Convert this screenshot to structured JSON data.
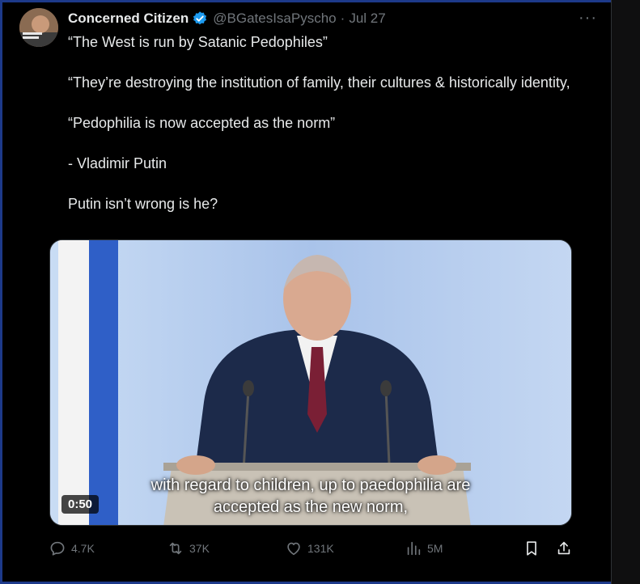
{
  "tweet": {
    "author_name": "Concerned Citizen",
    "handle": "@BGatesIsaPyscho",
    "separator": "·",
    "date": "Jul 27",
    "more_label": "···",
    "paragraphs": [
      "“The West is run by Satanic Pedophiles”",
      "“They’re destroying the institution of family, their cultures & historically identity,",
      "“Pedophilia is now accepted as the norm”",
      "- Vladimir Putin",
      "Putin isn’t wrong is he?"
    ]
  },
  "media": {
    "subtitle_line1": "with regard to children, up to paedophilia are",
    "subtitle_line2": "accepted as the new norm,",
    "duration": "0:50"
  },
  "actions": {
    "replies": "4.7K",
    "reposts": "37K",
    "likes": "131K",
    "views": "5M"
  },
  "icons": {
    "verified": "verified-badge-icon",
    "reply": "reply-icon",
    "repost": "repost-icon",
    "like": "heart-icon",
    "views": "views-icon",
    "bookmark": "bookmark-icon",
    "share": "share-icon"
  },
  "colors": {
    "background": "#000000",
    "text": "#e7e9ea",
    "muted": "#71767b",
    "verified": "#1d9bf0"
  }
}
